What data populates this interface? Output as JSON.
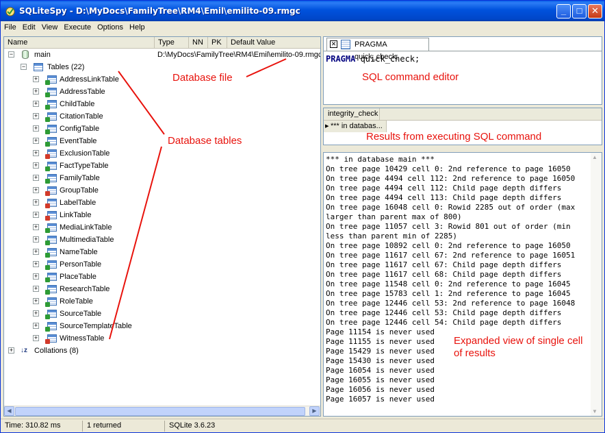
{
  "window": {
    "title": "SQLiteSpy - D:\\MyDocs\\FamilyTree\\RM4\\Emil\\emilito-09.rmgc",
    "minimize": "_",
    "maximize": "□",
    "close": "✕"
  },
  "menu": [
    "File",
    "Edit",
    "View",
    "Execute",
    "Options",
    "Help"
  ],
  "schema": {
    "columns": [
      "Name",
      "Type",
      "NN",
      "PK",
      "Default Value"
    ],
    "db_name": "main",
    "db_path": "D:\\MyDocs\\FamilyTree\\RM4\\Emil\\emilito-09.rmgc",
    "tables_label": "Tables (22)",
    "tables": [
      {
        "name": "AddressLinkTable",
        "badge": "green"
      },
      {
        "name": "AddressTable",
        "badge": "green"
      },
      {
        "name": "ChildTable",
        "badge": "green"
      },
      {
        "name": "CitationTable",
        "badge": "green"
      },
      {
        "name": "ConfigTable",
        "badge": "green"
      },
      {
        "name": "EventTable",
        "badge": "green"
      },
      {
        "name": "ExclusionTable",
        "badge": "red"
      },
      {
        "name": "FactTypeTable",
        "badge": "green"
      },
      {
        "name": "FamilyTable",
        "badge": "green"
      },
      {
        "name": "GroupTable",
        "badge": "red"
      },
      {
        "name": "LabelTable",
        "badge": "red"
      },
      {
        "name": "LinkTable",
        "badge": "red"
      },
      {
        "name": "MediaLinkTable",
        "badge": "green"
      },
      {
        "name": "MultimediaTable",
        "badge": "green"
      },
      {
        "name": "NameTable",
        "badge": "green"
      },
      {
        "name": "PersonTable",
        "badge": "green"
      },
      {
        "name": "PlaceTable",
        "badge": "green"
      },
      {
        "name": "ResearchTable",
        "badge": "green"
      },
      {
        "name": "RoleTable",
        "badge": "green"
      },
      {
        "name": "SourceTable",
        "badge": "green"
      },
      {
        "name": "SourceTemplateTable",
        "badge": "green"
      },
      {
        "name": "WitnessTable",
        "badge": "red"
      }
    ],
    "collations_label": "Collations (8)"
  },
  "editor": {
    "tab_label": "PRAGMA quick_check;",
    "keyword": "PRAGMA",
    "rest": " quick_check;"
  },
  "results": {
    "column": "integrity_check",
    "cell": "*** in databas..."
  },
  "detail_lines": [
    "*** in database main ***",
    "On tree page 10429 cell 0: 2nd reference to page 16050",
    "On tree page 4494 cell 112: 2nd reference to page 16050",
    "On tree page 4494 cell 112: Child page depth differs",
    "On tree page 4494 cell 113: Child page depth differs",
    "On tree page 16048 cell 0: Rowid 2285 out of order (max",
    "larger than parent max of 800)",
    "On tree page 11057 cell 3: Rowid 801 out of order (min",
    "less than parent min of 2285)",
    "On tree page 10892 cell 0: 2nd reference to page 16050",
    "On tree page 11617 cell 67: 2nd reference to page 16051",
    "On tree page 11617 cell 67: Child page depth differs",
    "On tree page 11617 cell 68: Child page depth differs",
    "On tree page 11548 cell 0: 2nd reference to page 16045",
    "On tree page 15783 cell 1: 2nd reference to page 16045",
    "On tree page 12446 cell 53: 2nd reference to page 16048",
    "On tree page 12446 cell 53: Child page depth differs",
    "On tree page 12446 cell 54: Child page depth differs",
    "Page 11154 is never used",
    "Page 11155 is never used",
    "Page 15429 is never used",
    "Page 15430 is never used",
    "Page 16054 is never used",
    "Page 16055 is never used",
    "Page 16056 is never used",
    "Page 16057 is never used"
  ],
  "status": {
    "time": "Time: 310.82 ms",
    "returned": "1 returned",
    "version": "SQLite 3.6.23"
  },
  "annotations": {
    "database_file": "Database file",
    "database_tables": "Database tables",
    "sql_editor": "SQL command editor",
    "results": "Results from executing SQL command",
    "expanded_1": "Expanded view of single cell",
    "expanded_2": "of results",
    "color": "#e8120c"
  }
}
